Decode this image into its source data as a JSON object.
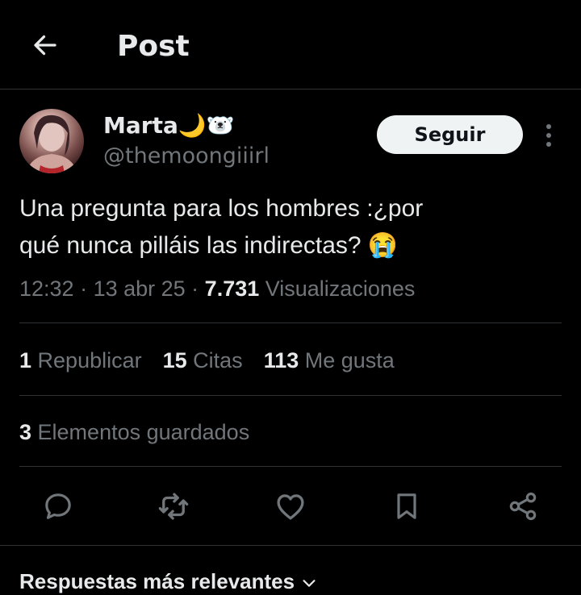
{
  "header": {
    "title": "Post",
    "back_icon": "arrow-left-icon"
  },
  "author": {
    "name": "Marta🌙🐻‍❄️",
    "handle": "@themoongiiirl",
    "follow_label": "Seguir",
    "more_icon": "more-vertical-icon"
  },
  "tweet": {
    "line1": "Una pregunta para los hombres :¿por",
    "line2": "qué nunca pilláis las indirectas? 😭"
  },
  "meta": {
    "time": "12:32",
    "sep1": " · ",
    "date": "13 abr 25",
    "sep2": " · ",
    "views_count": "7.731",
    "views_label": " Visualizaciones"
  },
  "stats": {
    "reposts_count": "1",
    "reposts_label": " Republicar",
    "quotes_count": "15",
    "quotes_label": " Citas",
    "likes_count": "113",
    "likes_label": " Me gusta",
    "bookmarks_count": "3",
    "bookmarks_label": " Elementos guardados"
  },
  "actions": [
    "reply-icon",
    "repost-icon",
    "like-icon",
    "bookmark-icon",
    "share-icon"
  ],
  "replies": {
    "sort_label": "Respuestas más relevantes"
  },
  "colors": {
    "background": "#000000",
    "text": "#e7e9ea",
    "muted": "#71767b",
    "divider": "#2f3336",
    "button_bg": "#eff3f4"
  }
}
